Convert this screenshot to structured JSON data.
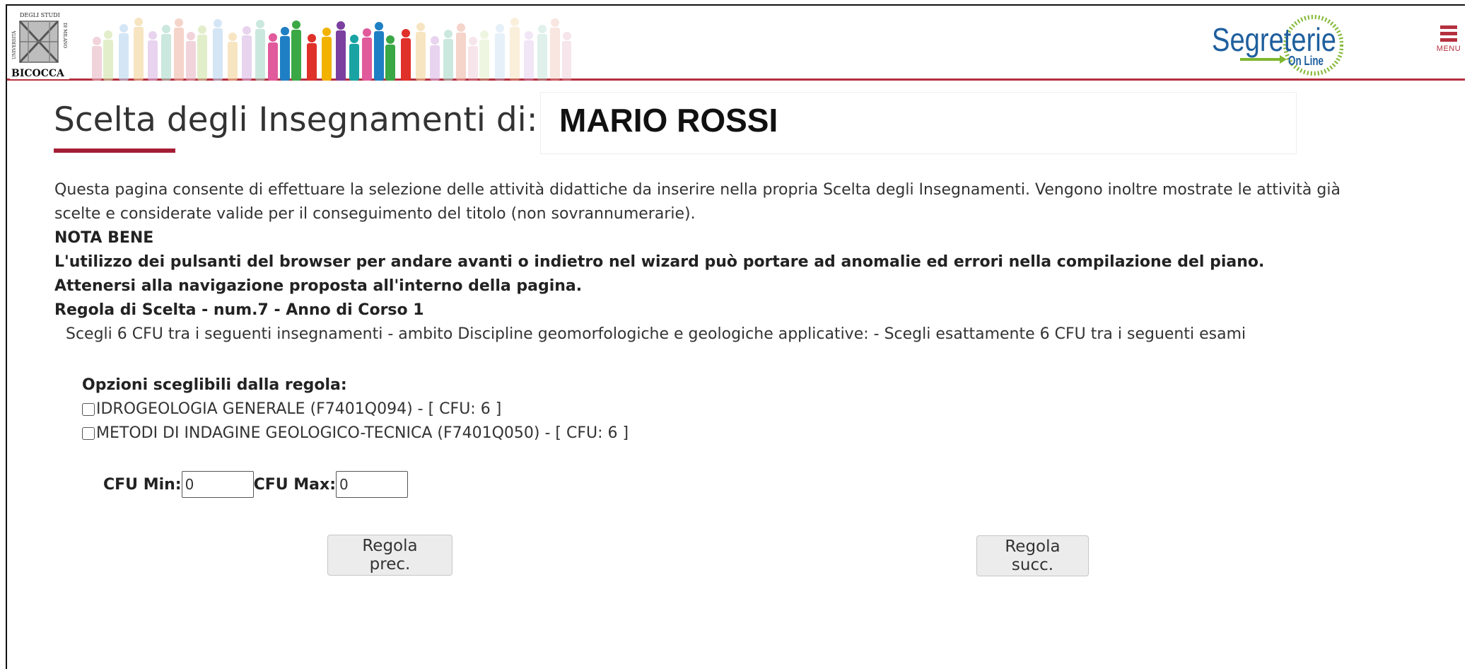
{
  "header": {
    "logo": {
      "text_top": "DEGLI STUDI",
      "text_side_left": "UNIVERSITÀ",
      "text_side_right": "DI MILANO",
      "text_bottom": "BICOCCA"
    },
    "segreterie_logo": {
      "line1": "Segreterie",
      "line2": "On Line"
    },
    "menu_label": "MENU"
  },
  "title": {
    "prefix": "Scelta degli Insegnamenti di:",
    "student_name": "MARIO ROSSI"
  },
  "content": {
    "description": "Questa pagina consente di effettuare la selezione delle attività didattiche da inserire nella propria Scelta degli Insegnamenti. Vengono inoltre mostrate le attività già scelte e considerate valide per il conseguimento del titolo (non sovrannumerarie).",
    "nota_bene_label": "NOTA BENE",
    "nota_bene_text": "L'utilizzo dei pulsanti del browser per andare avanti o indietro nel wizard può portare ad anomalie ed errori nella compilazione del piano. Attenersi alla navigazione proposta all'interno della pagina.",
    "rule_title": "Regola di Scelta - num.7 - Anno di Corso 1",
    "rule_description": "Scegli 6 CFU tra i seguenti insegnamenti - ambito Discipline geomorfologiche e geologiche applicative: - Scegli esattamente 6 CFU tra i seguenti esami"
  },
  "options": {
    "title": "Opzioni sceglibili dalla regola:",
    "items": [
      {
        "label": "IDROGEOLOGIA GENERALE (F7401Q094) - [ CFU: 6 ]",
        "checked": false
      },
      {
        "label": "METODI DI INDAGINE GEOLOGICO-TECNICA (F7401Q050) - [ CFU: 6 ]",
        "checked": false
      }
    ]
  },
  "cfu": {
    "min_label": "CFU Min:",
    "min_value": "0",
    "max_label": "CFU Max:",
    "max_value": "0"
  },
  "buttons": {
    "prev_label": "Regola prec.",
    "next_label": "Regola succ."
  },
  "colors": {
    "accent": "#b5303f",
    "title_underline": "#a41e34",
    "segreterie_blue": "#1f5f9e",
    "segreterie_green": "#7fb72f"
  }
}
